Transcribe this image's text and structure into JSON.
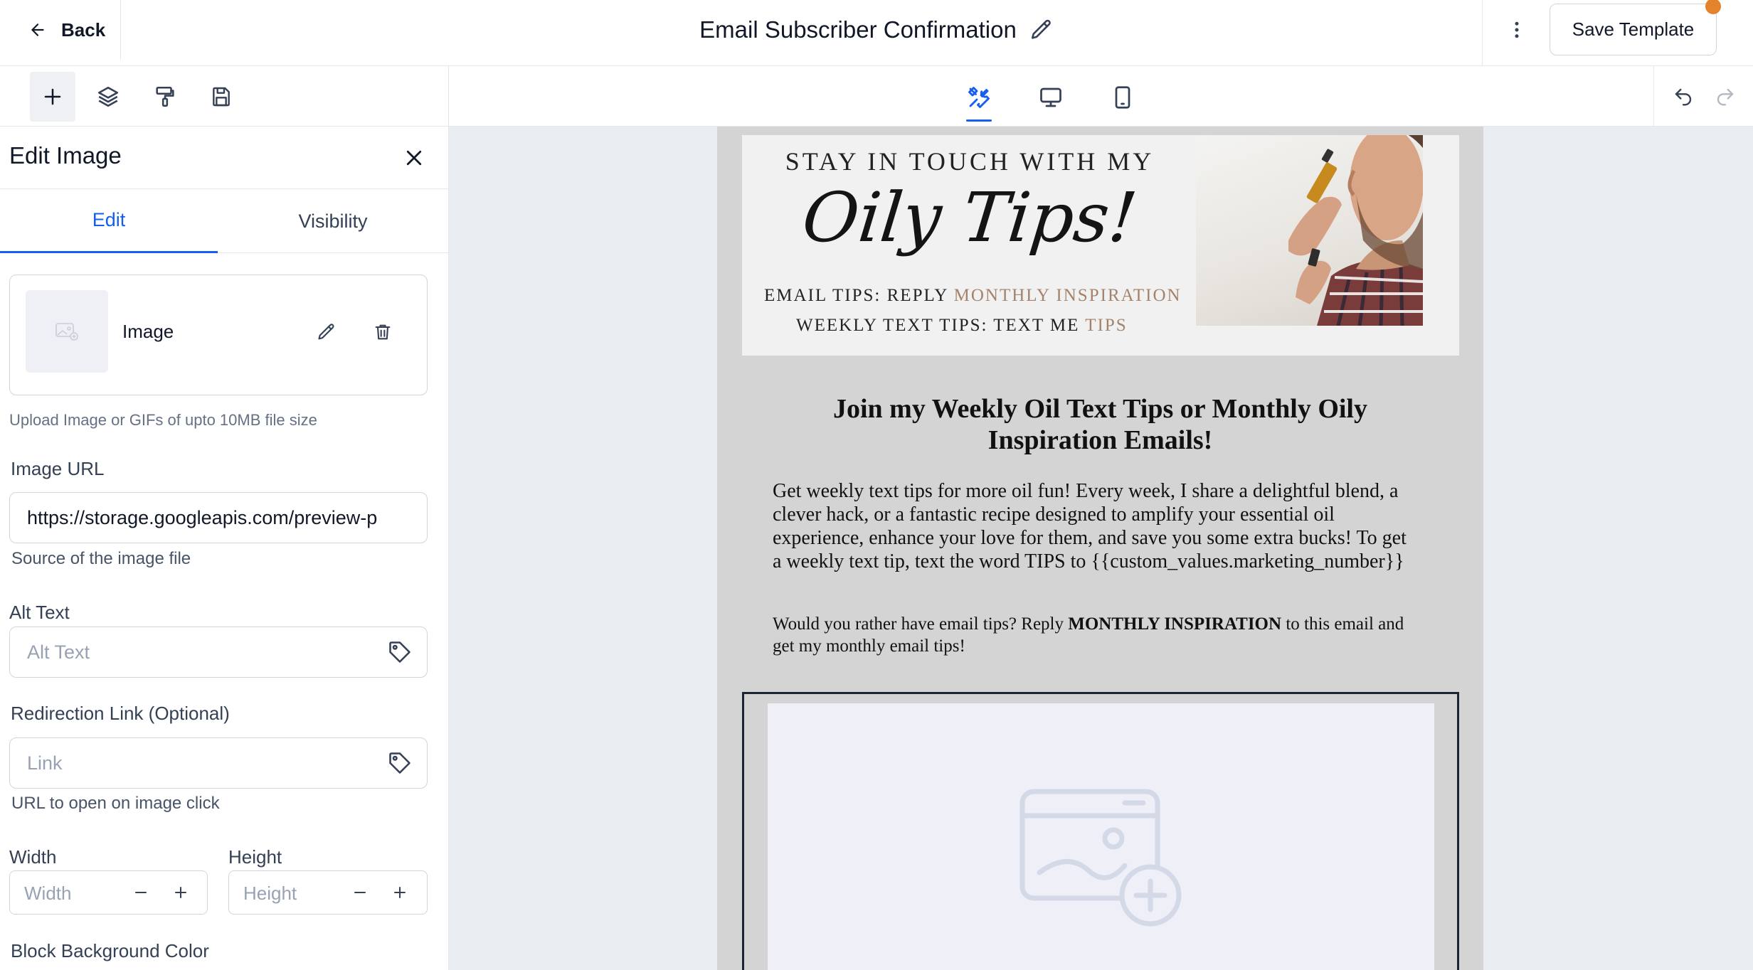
{
  "header": {
    "back_label": "Back",
    "title": "Email Subscriber Confirmation",
    "save_label": "Save Template"
  },
  "panel": {
    "title": "Edit Image",
    "tabs": [
      "Edit",
      "Visibility"
    ],
    "image_card_label": "Image",
    "upload_hint": "Upload Image or GIFs of upto 10MB file size",
    "image_url": {
      "label": "Image URL",
      "value": "https://storage.googleapis.com/preview-p",
      "hint": "Source of the image file"
    },
    "alt_text": {
      "label": "Alt Text",
      "placeholder": "Alt Text"
    },
    "redirect": {
      "label": "Redirection Link (Optional)",
      "placeholder": "Link",
      "hint": "URL to open on image click"
    },
    "width": {
      "label": "Width",
      "placeholder": "Width"
    },
    "height": {
      "label": "Height",
      "placeholder": "Height"
    },
    "bg_color_label": "Block Background Color"
  },
  "email": {
    "banner_line1": "STAY IN TOUCH WITH MY",
    "banner_script": "Oily Tips!",
    "banner_line3_a": "EMAIL TIPS: REPLY ",
    "banner_line3_b": "MONTHLY INSPIRATION",
    "banner_line4_a": "WEEKLY TEXT TIPS: TEXT ME ",
    "banner_line4_b": "TIPS",
    "heading": "Join my Weekly Oil Text Tips or Monthly Oily Inspiration Emails!",
    "paragraph1": "Get weekly text tips for more oil fun! Every week, I share a delightful blend, a clever hack, or a fantastic recipe designed to amplify your essential oil experience, enhance your love for them, and save you some extra bucks! To get a weekly text tip, text the word TIPS to {{custom_values.marketing_number}}",
    "paragraph2_a": "Would you rather have email tips? Reply ",
    "paragraph2_b": "MONTHLY INSPIRATION",
    "paragraph2_c": " to this email and get my monthly email tips!"
  },
  "colors": {
    "accent_blue": "#155eef",
    "notification_dot": "#e4832b",
    "email_background": "#d4d4d4",
    "canvas_background": "#eaedf2",
    "banner_accent": "#a4836c"
  },
  "icons": {
    "back": "arrow-left-icon",
    "title_edit": "pencil-icon",
    "more": "more-vertical-icon",
    "toolbar": [
      "plus-icon",
      "layers-icon",
      "paint-roller-icon",
      "save-icon"
    ],
    "views": [
      "tools-icon",
      "desktop-icon",
      "mobile-icon"
    ],
    "history": [
      "undo-icon",
      "redo-icon"
    ]
  }
}
